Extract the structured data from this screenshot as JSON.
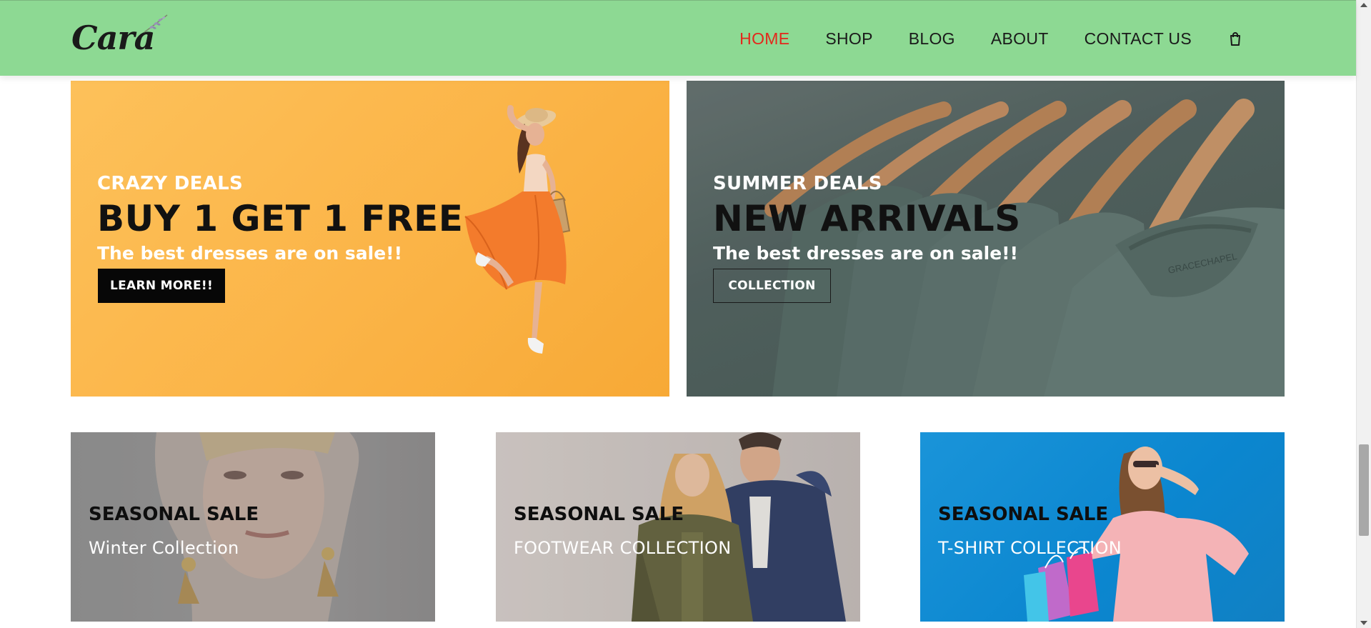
{
  "brand": {
    "logo_text": "Cara"
  },
  "nav": {
    "items": [
      {
        "label": "HOME",
        "active": true
      },
      {
        "label": "SHOP",
        "active": false
      },
      {
        "label": "BLOG",
        "active": false
      },
      {
        "label": "ABOUT",
        "active": false
      },
      {
        "label": "CONTACT US",
        "active": false
      }
    ],
    "cart_icon": "shopping-bag-icon",
    "active_color": "#e3281c",
    "header_bg": "#8dd993"
  },
  "banners": [
    {
      "eyebrow": "CRAZY DEALS",
      "title": "BUY 1 GET 1 FREE",
      "subtitle": "The best dresses are on sale!!",
      "button_label": "LEARN MORE!!",
      "background": "#fbb447"
    },
    {
      "eyebrow": "SUMMER DEALS",
      "title": "NEW ARRIVALS",
      "subtitle": "The best dresses are on sale!!",
      "button_label": "COLLECTION",
      "background": "#566764"
    }
  ],
  "cards": [
    {
      "title": "SEASONAL SALE",
      "subtitle": "Winter Collection"
    },
    {
      "title": "SEASONAL SALE",
      "subtitle": "FOOTWEAR COLLECTION"
    },
    {
      "title": "SEASONAL SALE",
      "subtitle": "T-SHIRT COLLECTION"
    }
  ],
  "shirt_label": "GRACECHAPEL"
}
